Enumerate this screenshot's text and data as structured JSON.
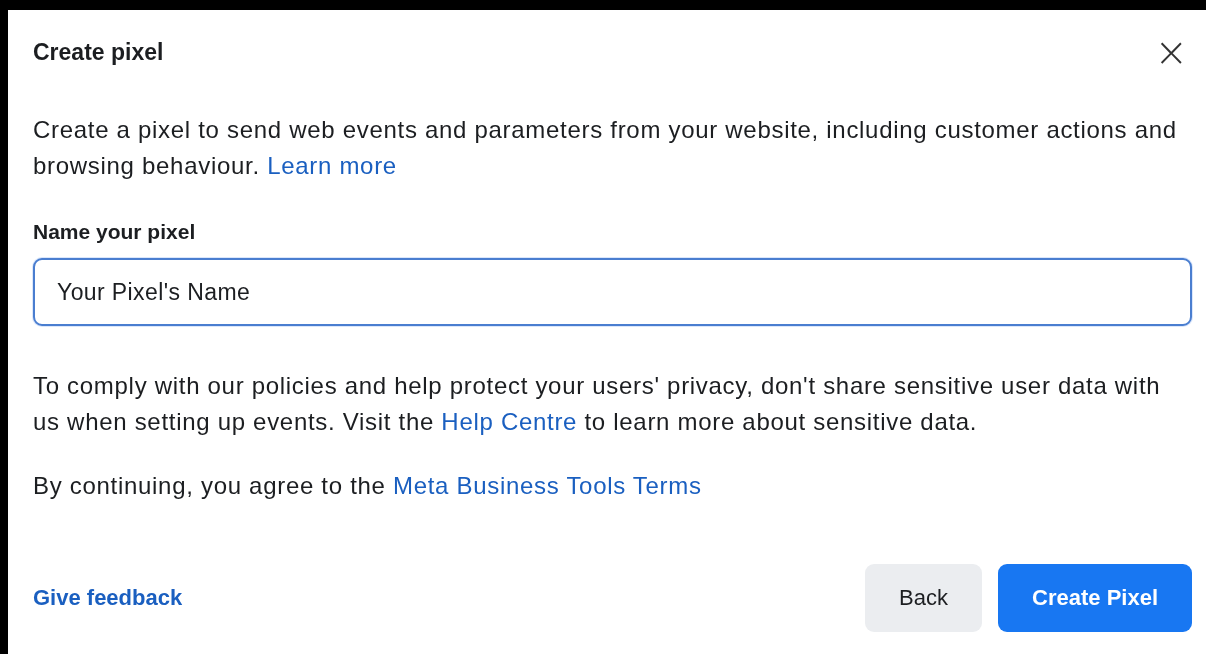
{
  "dialog": {
    "title": "Create pixel",
    "close": "×",
    "intro": {
      "text": "Create a pixel to send web events and parameters from your website, including customer actions and browsing behaviour.",
      "link": "Learn more"
    },
    "field": {
      "label": "Name your pixel",
      "value": "Your Pixel's Name",
      "focused": true
    },
    "privacy": {
      "before": "To comply with our policies and help protect your users' privacy, don't share sensitive user data with us when setting up events. Visit the",
      "link": "Help Centre",
      "after": "to learn more about sensitive data."
    },
    "terms": {
      "text": "By continuing, you agree to the",
      "link": "Meta Business Tools Terms"
    },
    "feedback": "Give feedback",
    "buttons": [
      {
        "label": "Back",
        "kind": "secondary"
      },
      {
        "label": "Create Pixel",
        "kind": "primary"
      }
    ]
  }
}
